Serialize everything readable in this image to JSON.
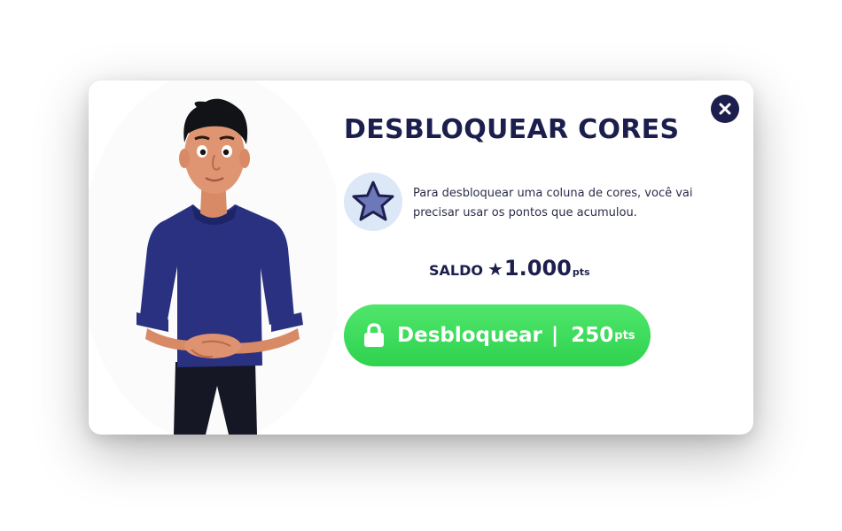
{
  "modal": {
    "title": "DESBLOQUEAR CORES",
    "info_text": "Para desbloquear uma coluna de cores, você vai precisar usar os pontos que acumulou.",
    "balance": {
      "label": "SALDO",
      "star": "★",
      "value": "1.000",
      "unit": "pts"
    },
    "unlock_button": {
      "label": "Desbloquear",
      "separator": "|",
      "cost": "250",
      "unit": "pts"
    }
  },
  "icons": {
    "close": "close-icon",
    "info": "star-icon",
    "lock": "lock-icon",
    "avatar": "sign-language-avatar"
  },
  "colors": {
    "navy": "#1c1f4d",
    "green": "#35d653",
    "icon_bg": "#dce8f7",
    "star_fill": "#6c78b8"
  }
}
